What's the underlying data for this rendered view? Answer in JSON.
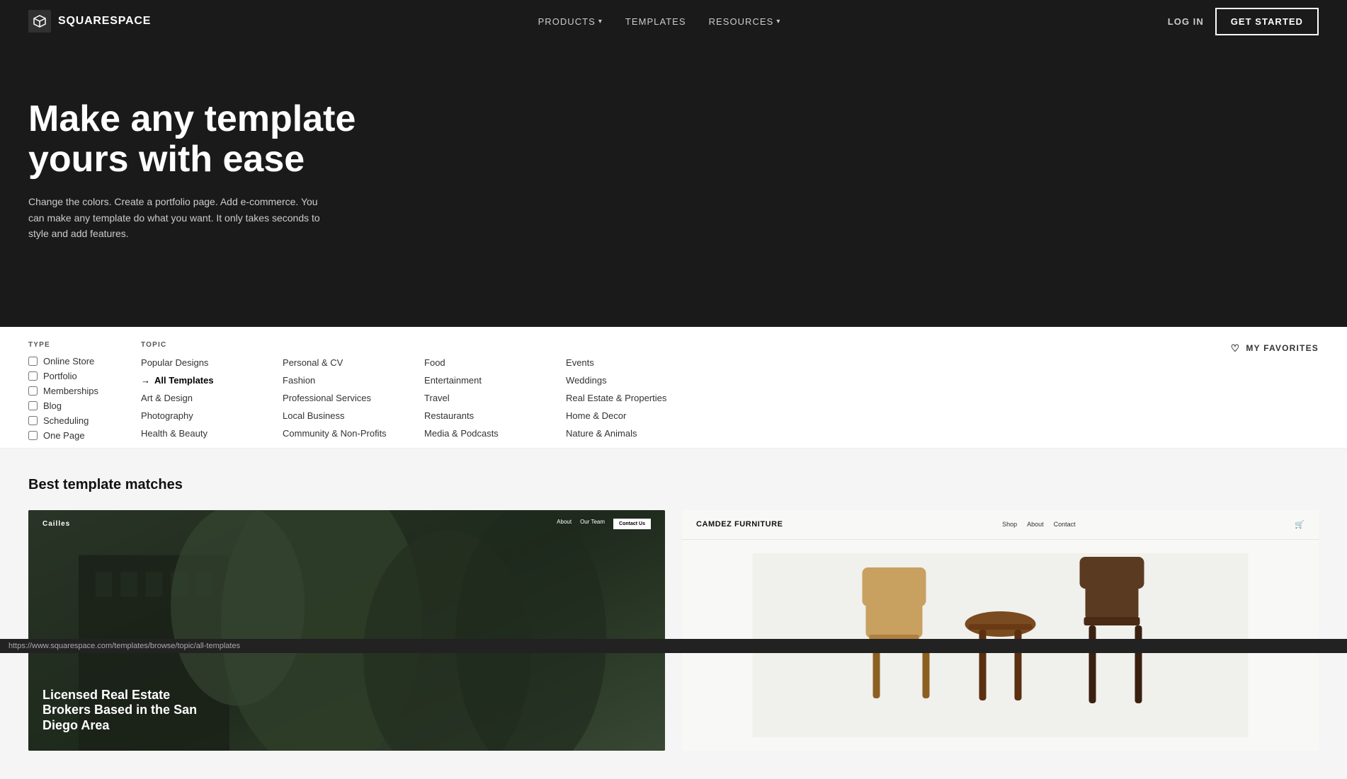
{
  "nav": {
    "logo_text": "SQUARESPACE",
    "links": [
      {
        "label": "PRODUCTS",
        "has_dropdown": true
      },
      {
        "label": "TEMPLATES",
        "has_dropdown": false
      },
      {
        "label": "RESOURCES",
        "has_dropdown": true
      }
    ],
    "login_label": "LOG IN",
    "get_started_label": "GET STARTED"
  },
  "hero": {
    "title": "Make any template yours with ease",
    "description": "Change the colors. Create a portfolio page. Add e-commerce. You can make any template do what you want. It only takes seconds to style and add features."
  },
  "filters": {
    "type_label": "TYPE",
    "topic_label": "TOPIC",
    "type_items": [
      {
        "label": "Online Store",
        "checked": false
      },
      {
        "label": "Portfolio",
        "checked": false
      },
      {
        "label": "Memberships",
        "checked": false
      },
      {
        "label": "Blog",
        "checked": false
      },
      {
        "label": "Scheduling",
        "checked": false
      },
      {
        "label": "One Page",
        "checked": false
      }
    ],
    "topic_columns": [
      {
        "items": [
          {
            "label": "Popular Designs",
            "active": false
          },
          {
            "label": "All Templates",
            "active": true
          },
          {
            "label": "Art & Design",
            "active": false
          },
          {
            "label": "Photography",
            "active": false
          },
          {
            "label": "Health & Beauty",
            "active": false
          }
        ]
      },
      {
        "items": [
          {
            "label": "Personal & CV",
            "active": false
          },
          {
            "label": "Fashion",
            "active": false
          },
          {
            "label": "Professional Services",
            "active": false
          },
          {
            "label": "Local Business",
            "active": false
          },
          {
            "label": "Community & Non-Profits",
            "active": false
          }
        ]
      },
      {
        "items": [
          {
            "label": "Food",
            "active": false
          },
          {
            "label": "Entertainment",
            "active": false
          },
          {
            "label": "Travel",
            "active": false
          },
          {
            "label": "Restaurants",
            "active": false
          },
          {
            "label": "Media & Podcasts",
            "active": false
          }
        ]
      },
      {
        "items": [
          {
            "label": "Events",
            "active": false
          },
          {
            "label": "Weddings",
            "active": false
          },
          {
            "label": "Real Estate & Properties",
            "active": false
          },
          {
            "label": "Home & Decor",
            "active": false
          },
          {
            "label": "Nature & Animals",
            "active": false
          }
        ]
      }
    ],
    "favorites_label": "MY FAVORITES"
  },
  "main": {
    "section_title": "Best template matches",
    "templates": [
      {
        "name": "Cailles",
        "subtitle": "Licensed Real Estate Brokers Based in the San Diego Area",
        "nav_links": [
          "About",
          "Our Team"
        ],
        "cta": "Contact Us"
      },
      {
        "name": "Camdez Furniture",
        "nav_links": [
          "Shop",
          "About",
          "Contact"
        ]
      }
    ]
  },
  "status_bar": {
    "url": "https://www.squarespace.com/templates/browse/topic/all-templates"
  }
}
